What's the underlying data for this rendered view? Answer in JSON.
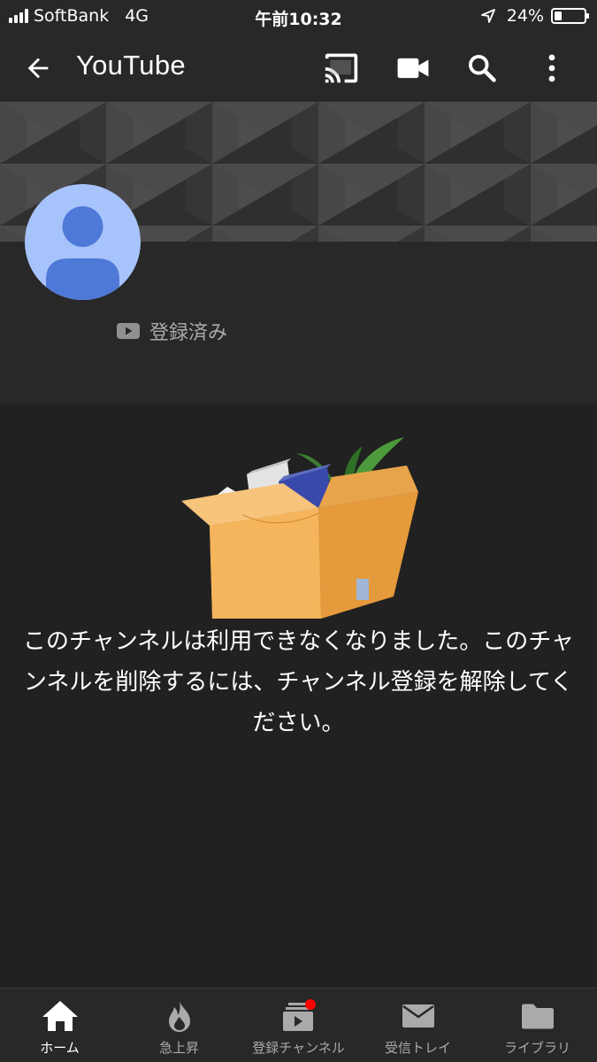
{
  "status_bar": {
    "carrier": "SoftBank",
    "network": "4G",
    "time": "午前10:32",
    "battery": "24%",
    "battery_level": 0.24
  },
  "app_bar": {
    "title": "YouTube",
    "icons": [
      "back-arrow-icon",
      "cast-icon",
      "video-camera-icon",
      "search-icon",
      "more-vert-icon"
    ]
  },
  "channel": {
    "subscribed_label": "登録済み"
  },
  "empty_state": {
    "message": "このチャンネルは利用できなくなりました。このチャンネルを削除するには、チャンネル登録を解除してください。"
  },
  "bottom_nav": {
    "items": [
      {
        "label": "ホーム",
        "icon": "home-icon",
        "active": true
      },
      {
        "label": "急上昇",
        "icon": "trending-flame-icon",
        "active": false
      },
      {
        "label": "登録チャンネル",
        "icon": "subscriptions-icon",
        "active": false
      },
      {
        "label": "受信トレイ",
        "icon": "inbox-mail-icon",
        "active": false
      },
      {
        "label": "ライブラリ",
        "icon": "library-folder-icon",
        "active": false
      }
    ]
  },
  "colors": {
    "background": "#212121",
    "bar": "#282828",
    "avatar_bg": "#a6c4fb",
    "avatar_fg": "#4f79d8",
    "notification_dot": "#ff0000",
    "muted_text": "#aaaaaa"
  }
}
